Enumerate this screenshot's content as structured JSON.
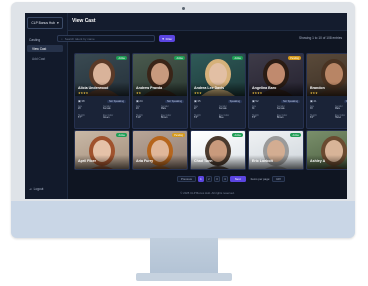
{
  "app": {
    "logo_label": "CLP Bonus Hub",
    "page_title": "View Cast"
  },
  "sidebar": {
    "group_label": "Casting",
    "items": [
      {
        "label": "View Cast",
        "active": true
      },
      {
        "label": "Add Cast",
        "active": false
      }
    ],
    "logout_label": "Logout"
  },
  "toolbar": {
    "search_placeholder": "Search talent by name",
    "filter_label": "Filter",
    "showing_text": "Showing 1 to 10 of 108 entries"
  },
  "cards": [
    {
      "name": "Alicia Underwood",
      "stars": "★★★★",
      "badge": "Active",
      "badge_color": "#1f9d55",
      "count": "38",
      "status": "Not Speaking",
      "fields": [
        {
          "k": "Age",
          "v": "29"
        },
        {
          "k": "Gender",
          "v": "Female"
        },
        {
          "k": "Height",
          "v": "5'7\""
        },
        {
          "k": "Eye Color",
          "v": "Green"
        }
      ]
    },
    {
      "name": "Andrew Pravda",
      "stars": "★★",
      "badge": "Active",
      "badge_color": "#1f9d55",
      "count": "24",
      "status": "Not Speaking",
      "fields": [
        {
          "k": "Age",
          "v": "24"
        },
        {
          "k": "Gender",
          "v": "Male"
        },
        {
          "k": "Height",
          "v": "5'10\""
        },
        {
          "k": "Eye Color",
          "v": "Brown"
        }
      ]
    },
    {
      "name": "Andrea Lee Davis",
      "stars": "★★★",
      "badge": "Active",
      "badge_color": "#1f9d55",
      "count": "35",
      "status": "Speaking",
      "fields": [
        {
          "k": "Age",
          "v": "27"
        },
        {
          "k": "Gender",
          "v": "Female"
        },
        {
          "k": "Height",
          "v": "5'6\""
        },
        {
          "k": "Eye Color",
          "v": "Blue"
        }
      ]
    },
    {
      "name": "Angelina Baro",
      "stars": "★★★★",
      "badge": "Pending",
      "badge_color": "#d69a1a",
      "count": "52",
      "status": "Not Speaking",
      "fields": [
        {
          "k": "Age",
          "v": "31"
        },
        {
          "k": "Gender",
          "v": "Female"
        },
        {
          "k": "Height",
          "v": "5'5\""
        },
        {
          "k": "Eye Color",
          "v": "Brown"
        }
      ]
    },
    {
      "name": "Brandon",
      "stars": "★★★",
      "badge": "Active",
      "badge_color": "#1f9d55",
      "count": "41",
      "status": "Speaking",
      "fields": [
        {
          "k": "Age",
          "v": "33"
        },
        {
          "k": "Gender",
          "v": "Male"
        },
        {
          "k": "Height",
          "v": "6'0\""
        },
        {
          "k": "Eye Color",
          "v": "Hazel"
        }
      ]
    },
    {
      "name": "April Fiber",
      "stars": "★★★",
      "badge": "Active",
      "badge_color": "#1f9d55",
      "count": "",
      "status": "",
      "fields": []
    },
    {
      "name": "Aria Furry",
      "stars": "★★★",
      "badge": "Pending",
      "badge_color": "#d69a1a",
      "count": "",
      "status": "",
      "fields": []
    },
    {
      "name": "Chad Tunn",
      "stars": "★★",
      "badge": "Active",
      "badge_color": "#1f9d55",
      "count": "",
      "status": "",
      "fields": []
    },
    {
      "name": "Eric Loebolt",
      "stars": "★★★",
      "badge": "Active",
      "badge_color": "#1f9d55",
      "count": "",
      "status": "",
      "fields": []
    },
    {
      "name": "Ashley A",
      "stars": "★★",
      "badge": "Active",
      "badge_color": "#1f9d55",
      "count": "",
      "status": "",
      "fields": []
    }
  ],
  "pagination": {
    "prev_label": "Previous",
    "pages": [
      "1",
      "2",
      "3",
      "4"
    ],
    "current": "1",
    "next_label": "Next",
    "per_page_label": "Items per page:",
    "per_page_value": "10"
  },
  "footer": {
    "text": "© 2025 CLP Bonus Hub. All rights reserved."
  }
}
